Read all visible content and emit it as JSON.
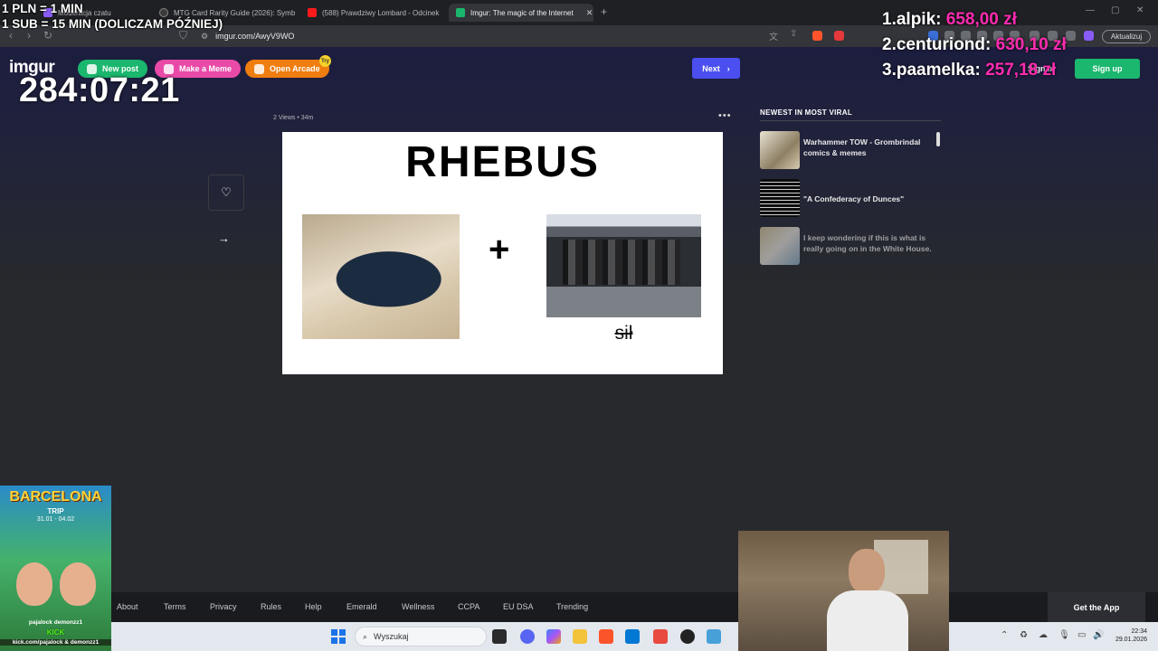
{
  "browser": {
    "tabs": [
      {
        "label": "Moderacja czatu",
        "active": false
      },
      {
        "label": "MTG Card Rarity Guide (2026): Symb",
        "active": false
      },
      {
        "label": "(588) Prawdziwy Lombard - Odcinek",
        "active": false
      },
      {
        "label": "Imgur: The magic of the Internet",
        "active": true
      }
    ],
    "new_tab": "+",
    "url": "imgur.com/AwyV9WO",
    "update_label": "Aktualizuj"
  },
  "imgur": {
    "logo": "imgur",
    "new_post": "New post",
    "make_meme": "Make a Meme",
    "open_arcade": "Open Arcade",
    "arcade_badge": "Try",
    "next": "Next",
    "sign_in": "Sign in",
    "sign_up": "Sign up",
    "post": {
      "views": "2 Views",
      "age": "34m",
      "menu": "•••",
      "image_title": "RHEBUS",
      "plus": "+",
      "struck_text": "sił"
    },
    "sidebar": {
      "title": "NEWEST IN MOST VIRAL",
      "items": [
        {
          "title": "Warhammer TOW - Grombrindal comics & memes"
        },
        {
          "title": "\"A Confederacy of Dunces\""
        },
        {
          "title": "I keep wondering if this is what is really going on in the White House."
        }
      ]
    },
    "footer": {
      "links": [
        "About",
        "Terms",
        "Privacy",
        "Rules",
        "Help",
        "Emerald",
        "Wellness",
        "CCPA",
        "EU DSA",
        "Trending"
      ],
      "get_app": "Get the App"
    }
  },
  "overlay": {
    "rate_line1": "1 PLN = 1 MIN",
    "rate_line2": "1 SUB = 15 MIN (DOLICZAM PÓŹNIEJ)",
    "timer": "284:07:21",
    "leaderboard": [
      {
        "rank": "1.",
        "name": "alpik:",
        "amount": "658,00 zł"
      },
      {
        "rank": "2.",
        "name": "centuriond:",
        "amount": "630,10 zł"
      },
      {
        "rank": "3.",
        "name": "paamelka:",
        "amount": "257,18 zł"
      }
    ],
    "poster": {
      "title": "BARCELONA",
      "subtitle": "TRIP",
      "dates": "31.01 - 04.02",
      "names": "pajalock    demonzz1",
      "kick": "KICK",
      "site": "kick.com/pajalock & demonzz1"
    }
  },
  "taskbar": {
    "search_placeholder": "Wyszukaj",
    "time": "22:34",
    "date": "29.01.2026"
  }
}
